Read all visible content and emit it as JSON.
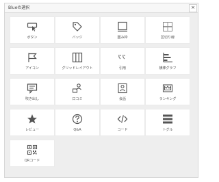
{
  "dialog": {
    "title": "Blueの選択",
    "close_symbol": "×"
  },
  "blocks": [
    {
      "label": "ボタン",
      "icon": "button-icon"
    },
    {
      "label": "バッジ",
      "icon": "tag-icon"
    },
    {
      "label": "囲み枠",
      "icon": "frame-icon"
    },
    {
      "label": "区切り線",
      "icon": "divider-icon"
    },
    {
      "label": "アイコン",
      "icon": "flag-icon"
    },
    {
      "label": "グリッドレイアウト",
      "icon": "grid-layout-icon"
    },
    {
      "label": "引用",
      "icon": "quote-icon"
    },
    {
      "label": "横棒グラフ",
      "icon": "bar-chart-icon"
    },
    {
      "label": "吹き出し",
      "icon": "speech-bubble-icon"
    },
    {
      "label": "口コミ",
      "icon": "review-icon"
    },
    {
      "label": "会話",
      "icon": "conversation-icon"
    },
    {
      "label": "ランキング",
      "icon": "ranking-icon"
    },
    {
      "label": "レビュー",
      "icon": "star-icon"
    },
    {
      "label": "Q&A",
      "icon": "question-icon"
    },
    {
      "label": "コード",
      "icon": "code-icon"
    },
    {
      "label": "トグル",
      "icon": "toggle-icon"
    },
    {
      "label": "QRコード",
      "icon": "qr-code-icon"
    }
  ]
}
